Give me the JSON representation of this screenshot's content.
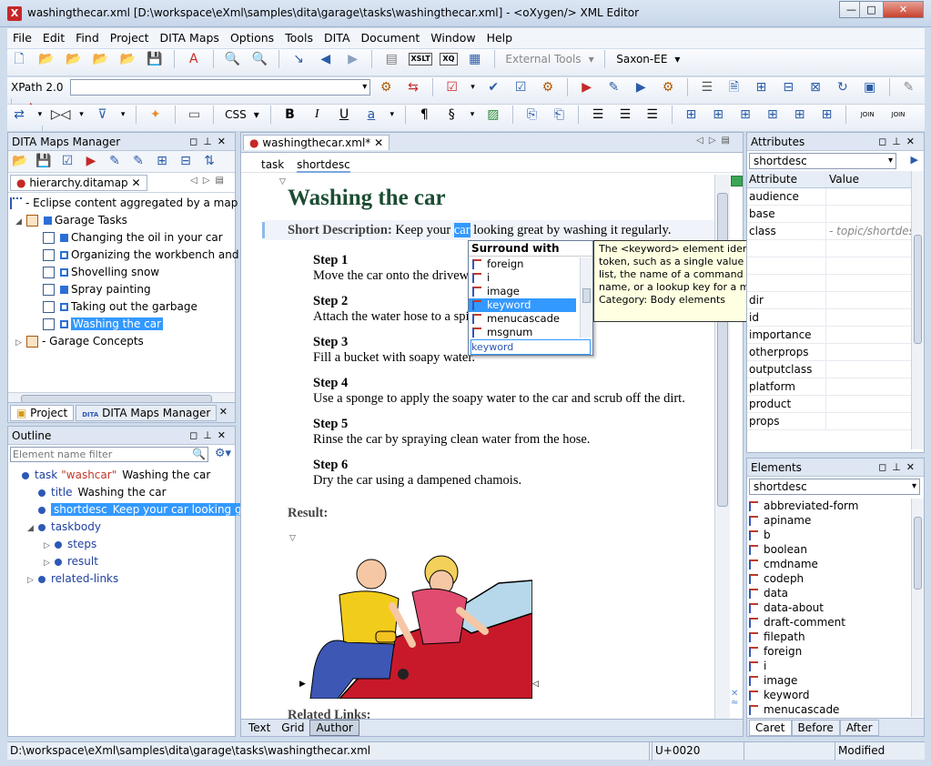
{
  "window": {
    "title": "washingthecar.xml [D:\\workspace\\eXml\\samples\\dita\\garage\\tasks\\washingthecar.xml] - <oXygen/> XML Editor",
    "app_icon": "X",
    "minimize": "—",
    "maximize": "□",
    "close": "✕"
  },
  "menu": [
    "File",
    "Edit",
    "Find",
    "Project",
    "DITA Maps",
    "Options",
    "Tools",
    "DITA",
    "Document",
    "Window",
    "Help"
  ],
  "toolbar": {
    "external_tools": "External Tools",
    "transformer": "Saxon-EE",
    "xpath_version": "XPath 2.0",
    "css_label": "CSS",
    "bold": "B",
    "italic": "I",
    "underline": "U",
    "link": "a",
    "xslt": "XSLT",
    "xq": "XQ",
    "join": "JOIN",
    "split": "SPLIT"
  },
  "dita_maps": {
    "title": "DITA Maps Manager",
    "tab": "hierarchy.ditamap",
    "root": "Eclipse content aggregated by a map",
    "items": [
      {
        "label": "Garage Tasks",
        "level": 1,
        "type": "folder"
      },
      {
        "label": "Changing the oil in your car",
        "level": 2,
        "type": "square"
      },
      {
        "label": "Organizing the workbench and tools",
        "level": 2,
        "type": "squareo"
      },
      {
        "label": "Shovelling snow",
        "level": 2,
        "type": "squareo"
      },
      {
        "label": "Spray painting",
        "level": 2,
        "type": "square"
      },
      {
        "label": "Taking out the garbage",
        "level": 2,
        "type": "squareo"
      },
      {
        "label": "Washing the car",
        "level": 2,
        "type": "squareo",
        "selected": true
      },
      {
        "label": "Garage Concepts",
        "level": 1,
        "type": "folder"
      }
    ],
    "bottom_tabs": [
      "Project",
      "DITA Maps Manager"
    ],
    "dita_badge": "DITA"
  },
  "outline": {
    "title": "Outline",
    "filter_placeholder": "Element name filter",
    "items": [
      {
        "tag": "task",
        "attr": "\"washcar\"",
        "text": "Washing the car",
        "level": 0
      },
      {
        "tag": "title",
        "attr": "",
        "text": "Washing the car",
        "level": 1
      },
      {
        "tag": "shortdesc",
        "attr": "",
        "text": "Keep your car looking great by",
        "level": 1,
        "selected": true
      },
      {
        "tag": "taskbody",
        "attr": "",
        "text": "",
        "level": 1
      },
      {
        "tag": "steps",
        "attr": "",
        "text": "",
        "level": 2
      },
      {
        "tag": "result",
        "attr": "",
        "text": "",
        "level": 2
      },
      {
        "tag": "related-links",
        "attr": "",
        "text": "",
        "level": 1
      }
    ]
  },
  "editor": {
    "tab": "washingthecar.xml*",
    "breadcrumb": [
      "task",
      "shortdesc"
    ],
    "doc_title": "Washing the car",
    "short_label": "Short Description:",
    "short_before": "Keep your",
    "short_sel": "car",
    "short_after": "looking great by washing it regularly.",
    "steps": [
      {
        "head": "Step 1",
        "text": "Move the car onto the driveway."
      },
      {
        "head": "Step 2",
        "text": "Attach the water hose to a spigot and drag the hose over to the car."
      },
      {
        "head": "Step 3",
        "text": "Fill a bucket with soapy water."
      },
      {
        "head": "Step 4",
        "text": "Use a sponge to apply the soapy water to the car and scrub off the dirt."
      },
      {
        "head": "Step 5",
        "text": "Rinse the car by spraying clean water from the hose."
      },
      {
        "head": "Step 6",
        "text": "Dry the car using a dampened chamois."
      }
    ],
    "result_label": "Result:",
    "related_label": "Related Links:",
    "modes": [
      "Text",
      "Grid",
      "Author"
    ]
  },
  "surround": {
    "title": "Surround with",
    "items": [
      "foreign",
      "i",
      "image",
      "keyword",
      "menucascade",
      "msgnum"
    ],
    "selected": "keyword",
    "input": "keyword"
  },
  "tooltip": {
    "text": "The <keyword> element identifies a keyword or token, such as a single value from an enumerated list, the name of a command or parameter, product name, or a lookup key for a message.",
    "category": "Category: Body elements"
  },
  "attributes": {
    "title": "Attributes",
    "element": "shortdesc",
    "col_attr": "Attribute",
    "col_value": "Value",
    "rows": [
      {
        "name": "audience",
        "value": ""
      },
      {
        "name": "base",
        "value": ""
      },
      {
        "name": "class",
        "value": "- topic/shortdesc"
      },
      {
        "name": "",
        "value": ""
      },
      {
        "name": "",
        "value": ""
      },
      {
        "name": "",
        "value": ""
      },
      {
        "name": "dir",
        "value": ""
      },
      {
        "name": "id",
        "value": ""
      },
      {
        "name": "importance",
        "value": ""
      },
      {
        "name": "otherprops",
        "value": ""
      },
      {
        "name": "outputclass",
        "value": ""
      },
      {
        "name": "platform",
        "value": ""
      },
      {
        "name": "product",
        "value": ""
      },
      {
        "name": "props",
        "value": ""
      }
    ]
  },
  "elements": {
    "title": "Elements",
    "element": "shortdesc",
    "items": [
      "abbreviated-form",
      "apiname",
      "b",
      "boolean",
      "cmdname",
      "codeph",
      "data",
      "data-about",
      "draft-comment",
      "filepath",
      "foreign",
      "i",
      "image",
      "keyword",
      "menucascade"
    ],
    "tabs": [
      "Caret",
      "Before",
      "After"
    ]
  },
  "status": {
    "path": "D:\\workspace\\eXml\\samples\\dita\\garage\\tasks\\washingthecar.xml",
    "unicode": "U+0020",
    "state": "Modified"
  }
}
